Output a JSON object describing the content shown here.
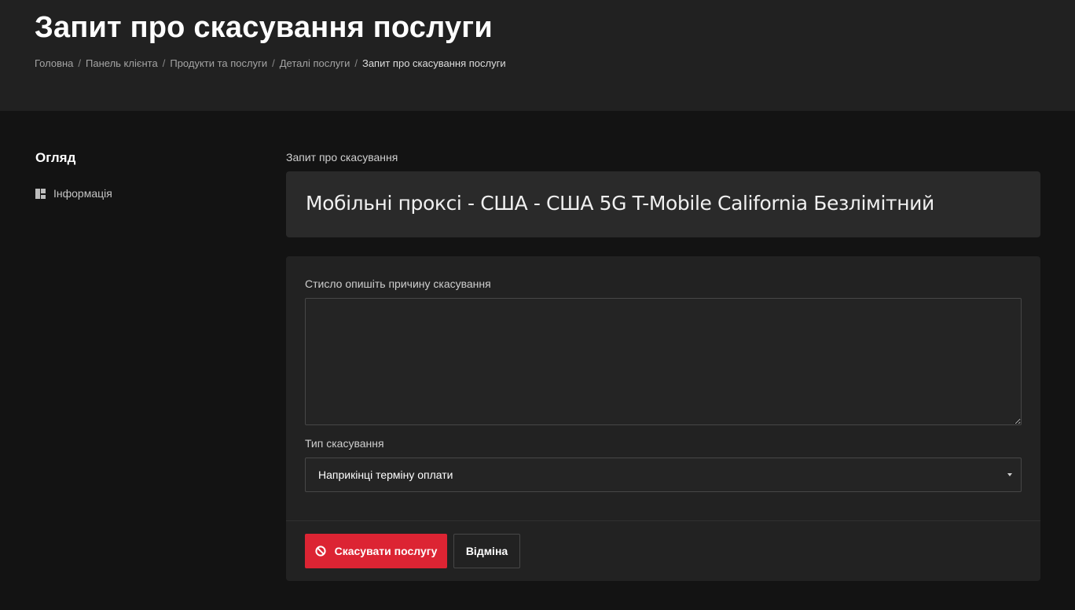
{
  "header": {
    "title": "Запит про скасування послуги",
    "breadcrumb": [
      "Головна",
      "Панель клієнта",
      "Продукти та послуги",
      "Деталі послуги",
      "Запит про скасування послуги"
    ],
    "breadcrumb_separator": "/"
  },
  "sidebar": {
    "title": "Огляд",
    "items": [
      {
        "label": "Інформація",
        "icon": "dashboard-icon"
      }
    ]
  },
  "main": {
    "section_label": "Запит про скасування",
    "product_name": "Мобільні проксі - США - США 5G T-Mobile California Безлімітний",
    "form": {
      "reason_label": "Стисло опишіть причину скасування",
      "reason_value": "",
      "type_label": "Тип скасування",
      "type_selected": "Наприкінці терміну оплати",
      "submit_label": "Скасувати послугу",
      "submit_icon": "ban-icon",
      "back_label": "Відміна"
    }
  },
  "colors": {
    "background": "#131313",
    "header_background": "#212121",
    "card_background": "#2a2a2a",
    "form_background": "#222222",
    "accent_red": "#dc2433"
  }
}
